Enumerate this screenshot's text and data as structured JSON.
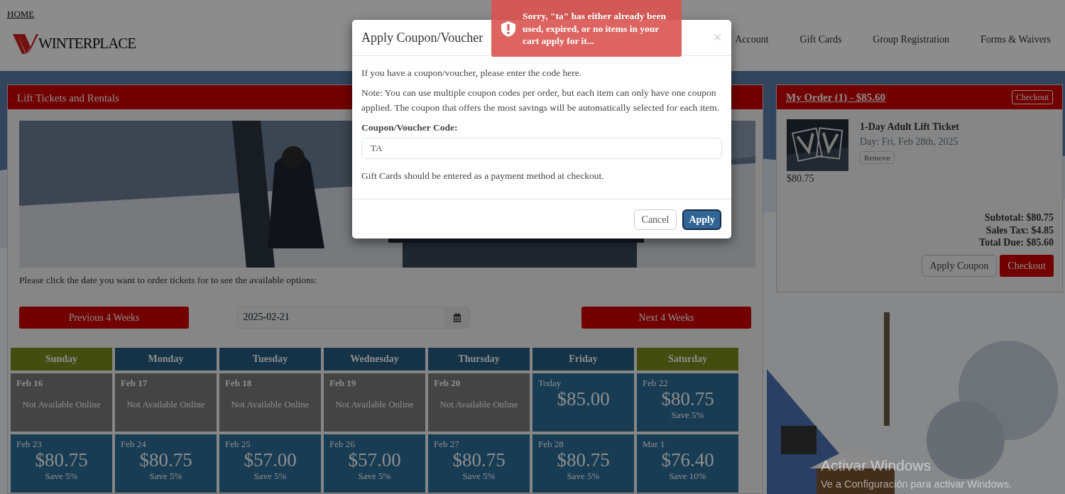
{
  "header": {
    "home_link": "HOME",
    "logo_text": "WINTERPLACE",
    "nav": [
      "Account",
      "Gift Cards",
      "Group Registration",
      "Forms & Waivers"
    ]
  },
  "tickets_panel": {
    "title": "Lift Tickets and Rentals",
    "instruction": "Please click the date you want to order tickets for to see the available options:",
    "previous_button": "Previous 4 Weeks",
    "date_field": {
      "value": "2025-02-21"
    },
    "next_button": "Next 4 Weeks",
    "calendar": {
      "days": [
        {
          "label": "Sunday",
          "kind": "weekend"
        },
        {
          "label": "Monday",
          "kind": "weekday"
        },
        {
          "label": "Tuesday",
          "kind": "weekday"
        },
        {
          "label": "Wednesday",
          "kind": "weekday"
        },
        {
          "label": "Thursday",
          "kind": "weekday"
        },
        {
          "label": "Friday",
          "kind": "weekday"
        },
        {
          "label": "Saturday",
          "kind": "weekend"
        }
      ],
      "weeks": [
        [
          {
            "kind": "unavailable",
            "date": "Feb 16",
            "text": "Not Available Online"
          },
          {
            "kind": "unavailable",
            "date": "Feb 17",
            "text": "Not Available Online"
          },
          {
            "kind": "unavailable",
            "date": "Feb 18",
            "text": "Not Available Online"
          },
          {
            "kind": "unavailable",
            "date": "Feb 19",
            "text": "Not Available Online"
          },
          {
            "kind": "unavailable",
            "date": "Feb 20",
            "text": "Not Available Online"
          },
          {
            "kind": "price",
            "date": "Today",
            "price": "$85.00"
          },
          {
            "kind": "price",
            "date": "Feb 22",
            "price": "$80.75",
            "saving": "Save 5%"
          }
        ],
        [
          {
            "kind": "price",
            "date": "Feb 23",
            "price": "$80.75",
            "saving": "Save 5%"
          },
          {
            "kind": "price",
            "date": "Feb 24",
            "price": "$80.75",
            "saving": "Save 5%"
          },
          {
            "kind": "price",
            "date": "Feb 25",
            "price": "$57.00",
            "saving": "Save 5%"
          },
          {
            "kind": "price",
            "date": "Feb 26",
            "price": "$57.00",
            "saving": "Save 5%"
          },
          {
            "kind": "price",
            "date": "Feb 27",
            "price": "$80.75",
            "saving": "Save 5%"
          },
          {
            "kind": "price",
            "date": "Feb 28",
            "price": "$80.75",
            "saving": "Save 5%"
          },
          {
            "kind": "price",
            "date": "Mar 1",
            "price": "$76.40",
            "saving": "Save 10%"
          }
        ]
      ]
    }
  },
  "order_panel": {
    "title": "My Order (1) - $85.60",
    "header_button": "Checkout",
    "items": [
      {
        "name": "1-Day Adult Lift Ticket",
        "day": "Day: Fri, Feb 28th, 2025",
        "remove": "Remove",
        "price": "$80.75"
      }
    ],
    "totals": [
      "Subtotal: $80.75",
      "Sales Tax: $4.85",
      "Total Due: $85.60"
    ],
    "apply_coupon_button": "Apply Coupon",
    "checkout_button": "Checkout"
  },
  "modal": {
    "title": "Apply Coupon/Voucher",
    "intro": "If you have a coupon/voucher, please enter the code here.",
    "note": "Note: You can use multiple coupon codes per order, but each item can only have one coupon applied. The coupon that offers the most savings will be automatically selected for each item.",
    "field_label": "Coupon/Voucher Code:",
    "field_value": "TA",
    "gift_note": "Gift Cards should be entered as a payment method at checkout.",
    "cancel_button": "Cancel",
    "apply_button": "Apply"
  },
  "toast": {
    "message": "Sorry, \"ta\" has either already been used, expired, or no items in your cart apply for it..."
  },
  "windows_notice": {
    "title": "Activar Windows",
    "text": "Ve a Configuración para activar Windows."
  }
}
